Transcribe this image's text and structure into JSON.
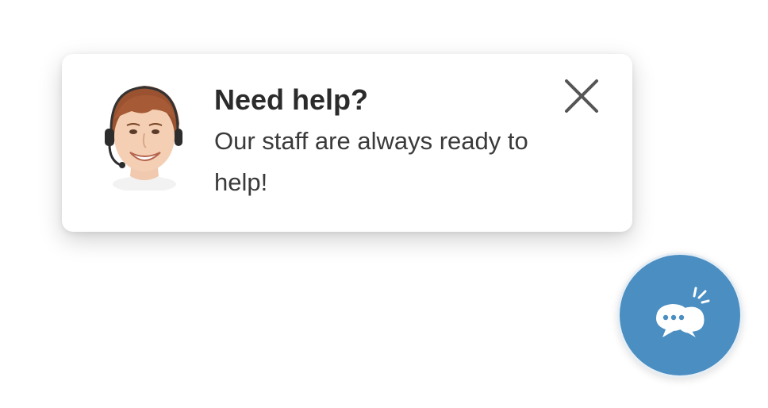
{
  "popup": {
    "title": "Need help?",
    "message": "Our staff are always ready to help!",
    "avatar_icon": "support-agent-avatar",
    "close_icon": "close-icon"
  },
  "launcher": {
    "icon": "chat-bubbles-icon",
    "accent_color": "#4a8ec2"
  }
}
